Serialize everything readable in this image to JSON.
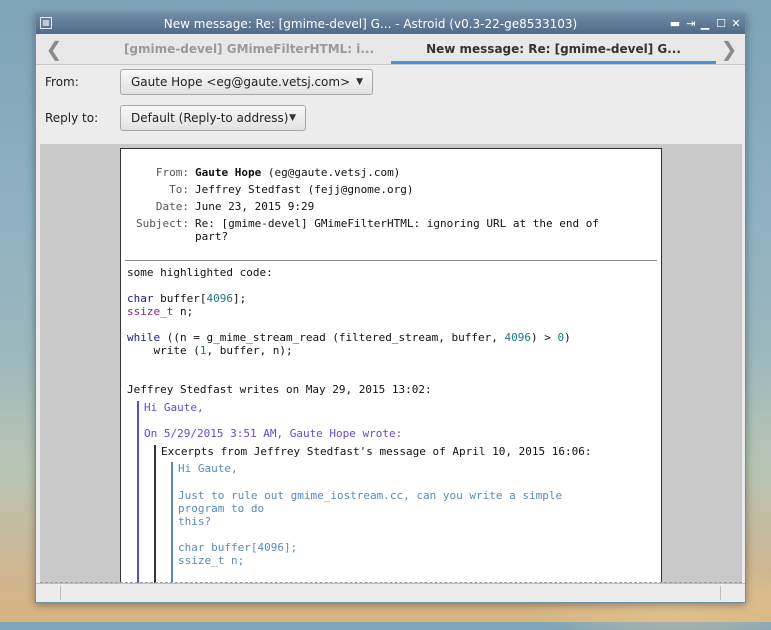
{
  "window": {
    "title": "New message: Re: [gmime-devel] G... - Astroid (v0.3-22-ge8533103)",
    "controls": {
      "minimize": "▬",
      "pin": "⇥",
      "iconify": "▁",
      "maximize": "☐",
      "close": "✕"
    }
  },
  "tabs": [
    {
      "label": "[gmime-devel] GMimeFilterHTML: i..."
    },
    {
      "label": "New message: Re: [gmime-devel] G..."
    }
  ],
  "nav": {
    "prev": "❮",
    "next": "❯"
  },
  "compose": {
    "from_label": "From:",
    "from_value": "Gaute Hope <eg@gaute.vetsj.com>",
    "replyto_label": "Reply to:",
    "replyto_value": "Default (Reply-to address)"
  },
  "message": {
    "headers": {
      "from_key": "From:",
      "from_name": "Gaute Hope",
      "from_addr": " (eg@gaute.vetsj.com)",
      "to_key": "To:",
      "to_value": "Jeffrey Stedfast (fejj@gnome.org)",
      "date_key": "Date:",
      "date_value": "June 23, 2015 9:29",
      "subject_key": "Subject:",
      "subject_line1": "Re: [gmime-devel] GMimeFilterHTML: ignoring URL at the end of",
      "subject_line2": "part?"
    },
    "body": {
      "intro": "some highlighted code:",
      "code1_type": "char",
      "code1_rest": " buffer[",
      "code1_num": "4096",
      "code1_end": "];",
      "code2_type": "ssize_t",
      "code2_rest": " n;",
      "code3_kw": "while",
      "code3_a": " ((n = g_mime_stream_read ",
      "code3_b": "(filtered_stream, buffer, ",
      "code3_num": "4096",
      "code3_c": ") > ",
      "code3_zero": "0",
      "code3_d": ")",
      "code4_a": "    write ",
      "code4_b": "(",
      "code4_num": "1",
      "code4_c": ", buffer, n);",
      "attribution": "Jeffrey Stedfast writes on May 29, 2015 13:02:",
      "q1_hi": "Hi Gaute,",
      "q1_attr": "On 5/29/2015 3:51 AM, Gaute Hope wrote:",
      "q2_attr": "Excerpts from Jeffrey Stedfast's message of April 10, 2015 16:06:",
      "q3_hi": "Hi Gaute,",
      "q3_l1": "Just to rule out gmime_iostream.cc, can you write a simple",
      "q3_l2": "program to do",
      "q3_l3": "this?",
      "q3_c1": "char buffer[4096];",
      "q3_c2": "ssize_t n;"
    }
  },
  "colors": {
    "accent": "#4a90d9",
    "titlebar": "#5a7794",
    "quote1": "#5b4ed6",
    "quote2": "#5b8ab8"
  }
}
